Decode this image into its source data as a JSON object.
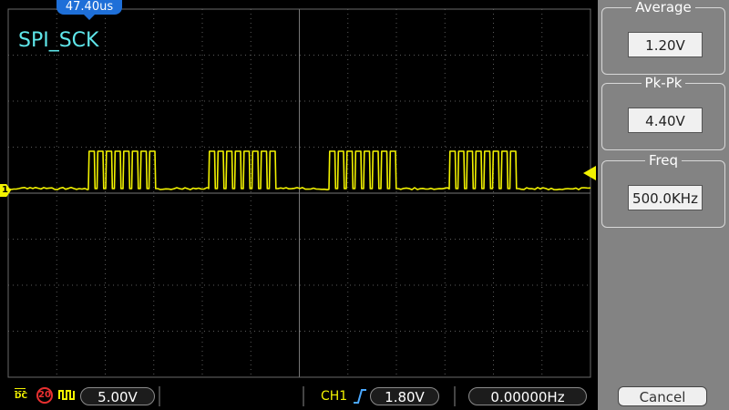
{
  "timebase_badge": "47.40us",
  "channel_name": "SPI_SCK",
  "ch1_marker": "1",
  "measurements": [
    {
      "title": "Average",
      "value": "1.20V"
    },
    {
      "title": "Pk-Pk",
      "value": "4.40V"
    },
    {
      "title": "Freq",
      "value": "500.0KHz"
    }
  ],
  "cancel_label": "Cancel",
  "status_bar": {
    "coupling": "DC",
    "bandwidth_limit": "20",
    "volts_div": "5.00V",
    "trigger_source": "CH1",
    "trigger_level": "1.80V",
    "counter_freq": "0.00000Hz"
  },
  "colors": {
    "trace": "#f2f200",
    "label": "#5fe6ea",
    "badge": "#1e6fd8",
    "side_panel": "#838383"
  },
  "icons": {
    "coupling": "dc-coupling-icon",
    "bandwidth": "bandwidth-limit-icon",
    "invert": "waveform-invert-icon",
    "trigger_edge": "rising-edge-icon"
  },
  "waveform": {
    "bursts": 4,
    "pulses_per_burst": 8,
    "baseline": "low"
  }
}
